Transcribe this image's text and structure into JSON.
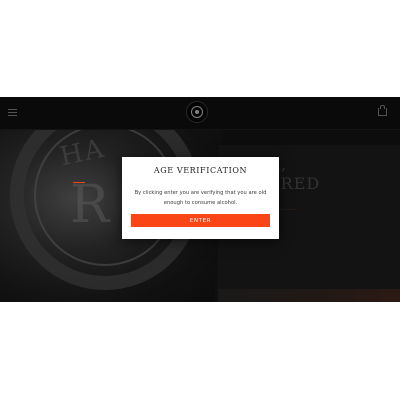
{
  "site": {
    "icons": {
      "menu": "hamburger-menu-icon",
      "logo": "brewery-logo",
      "cart": "shopping-bag-icon"
    },
    "hero": {
      "title_line1": "R,",
      "title_line2": "ERED",
      "accent_color": "#f04e23"
    }
  },
  "age_modal": {
    "title": "AGE VERIFICATION",
    "message": "By clicking enter you are verifying that you are old enough to consume alcohol.",
    "enter_label": "ENTER",
    "button_color": "#fa4616"
  }
}
